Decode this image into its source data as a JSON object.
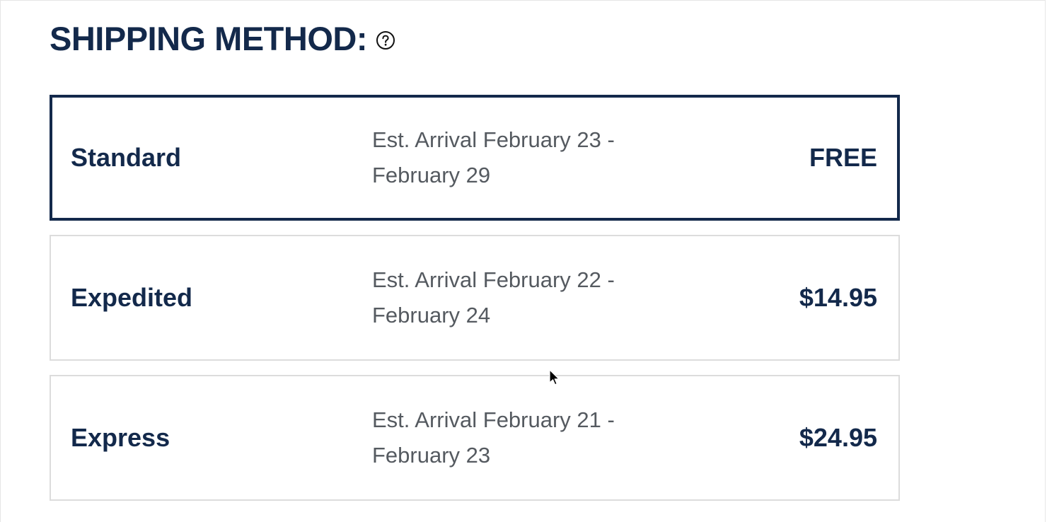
{
  "shipping": {
    "title": "SHIPPING METHOD:",
    "help_icon": "question-circle-icon",
    "options": [
      {
        "name": "Standard",
        "eta_line1": "Est. Arrival February 23 -",
        "eta_line2": "February 29",
        "price": "FREE",
        "selected": true
      },
      {
        "name": "Expedited",
        "eta_line1": "Est. Arrival February 22 -",
        "eta_line2": "February 24",
        "price": "$14.95",
        "selected": false
      },
      {
        "name": "Express",
        "eta_line1": "Est. Arrival February 21 -",
        "eta_line2": "February 23",
        "price": "$24.95",
        "selected": false
      }
    ]
  },
  "colors": {
    "primary_text": "#13294b",
    "secondary_text": "#555a60",
    "selected_border": "#13294b",
    "unselected_border": "#dcdcdc"
  },
  "cursor_icon": "mouse-pointer-icon"
}
